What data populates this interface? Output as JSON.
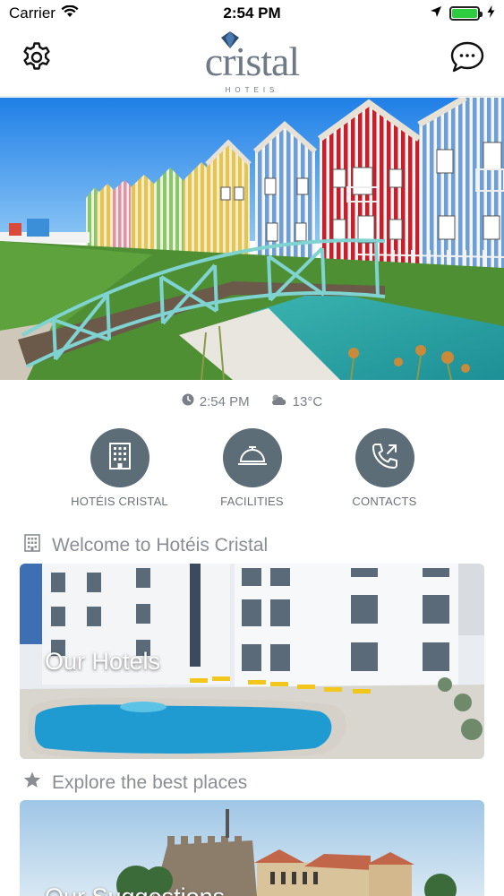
{
  "status_bar": {
    "carrier": "Carrier",
    "time": "2:54 PM"
  },
  "header": {
    "brand_name": "cristal",
    "brand_sub": "HOTEIS",
    "settings_icon": "gear-icon",
    "chat_icon": "chat-bubble-icon"
  },
  "info": {
    "time": "2:54 PM",
    "weather": "13°C"
  },
  "actions": [
    {
      "label": "HOTÉIS CRISTAL",
      "icon": "building-icon"
    },
    {
      "label": "FACILITIES",
      "icon": "service-bell-icon"
    },
    {
      "label": "CONTACTS",
      "icon": "phone-icon"
    }
  ],
  "sections": {
    "welcome": {
      "title": "Welcome to Hotéis Cristal",
      "icon": "building-icon"
    },
    "explore": {
      "title": "Explore the best places",
      "icon": "star-icon"
    }
  },
  "cards": {
    "hotels": {
      "title": "Our Hotels"
    },
    "suggestions": {
      "title": "Our Suggestions"
    }
  },
  "colors": {
    "accent": "#5c6d78",
    "muted_text": "#8a8d92",
    "battery": "#2ecc40"
  }
}
